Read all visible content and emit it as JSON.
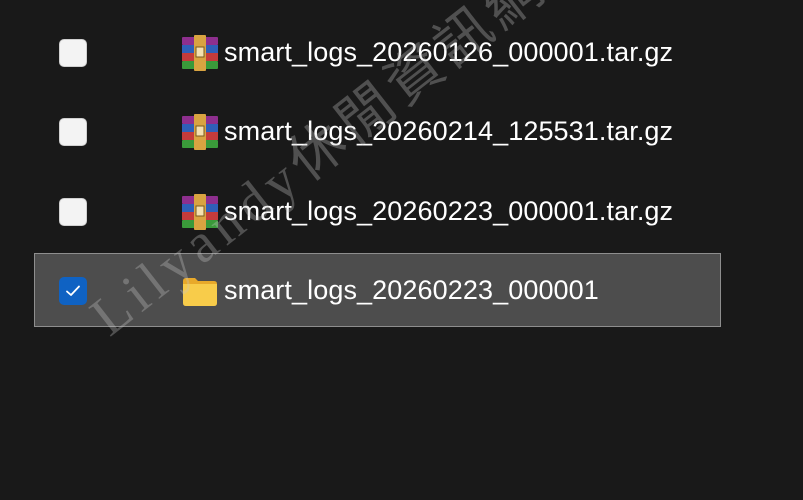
{
  "files": [
    {
      "name": "smart_logs_20260126_000001.tar.gz",
      "type": "archive",
      "icon": "winrar-archive-icon",
      "checked": false,
      "selected": false
    },
    {
      "name": "smart_logs_20260214_125531.tar.gz",
      "type": "archive",
      "icon": "winrar-archive-icon",
      "checked": false,
      "selected": false
    },
    {
      "name": "smart_logs_20260223_000001.tar.gz",
      "type": "archive",
      "icon": "winrar-archive-icon",
      "checked": false,
      "selected": false
    },
    {
      "name": "smart_logs_20260223_000001",
      "type": "folder",
      "icon": "folder-icon",
      "checked": true,
      "selected": true
    }
  ],
  "watermark": {
    "text": "Lilyandy休閒資訊網"
  },
  "colors": {
    "background": "#191919",
    "selected_row": "#4d4d4d",
    "checkbox_accent": "#0f62c3",
    "text": "#ffffff"
  }
}
